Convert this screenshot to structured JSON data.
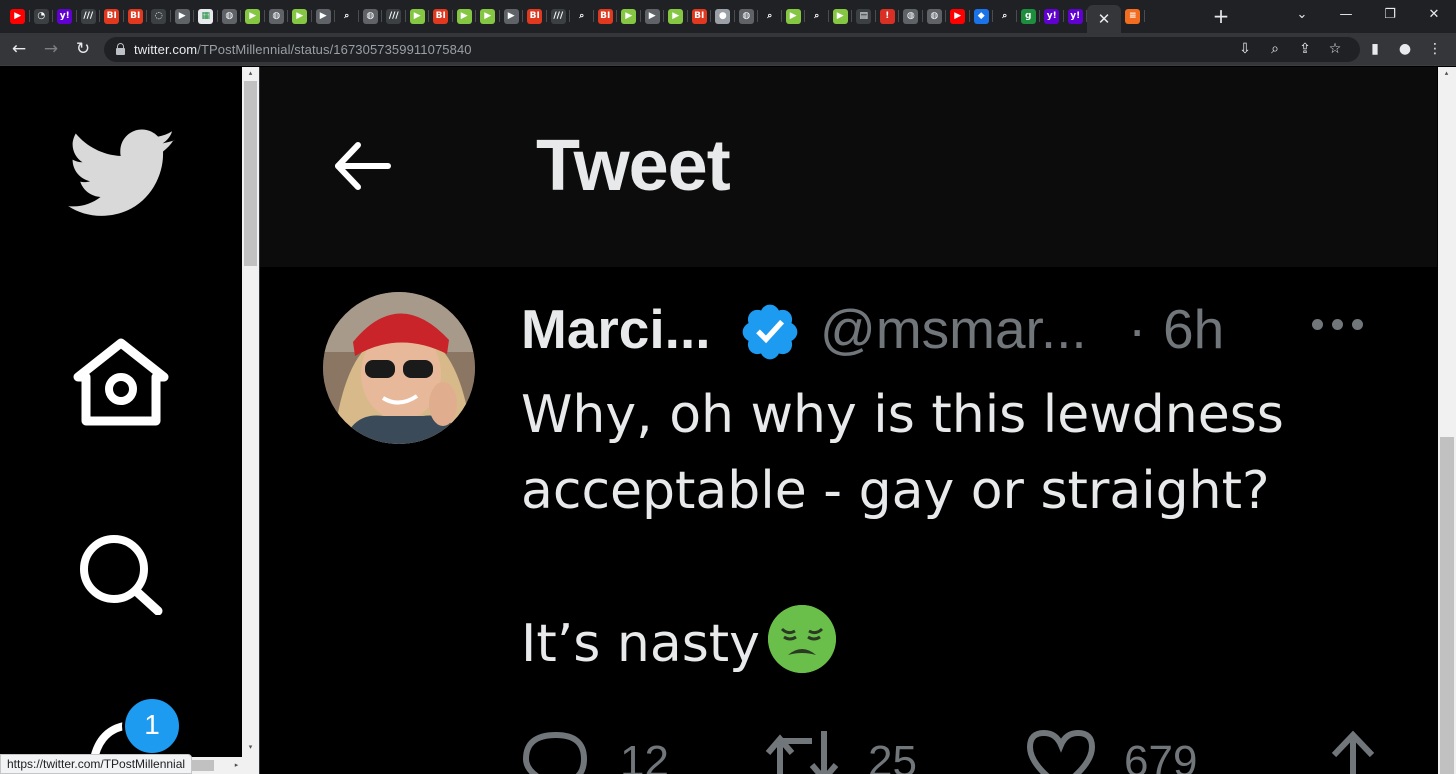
{
  "browser": {
    "tabs": [
      {
        "icon": "youtube-icon",
        "label": "",
        "color": "#ff0000",
        "glyph": "▶"
      },
      {
        "icon": "generic-icon",
        "label": "",
        "color": "#3c4043",
        "glyph": "◔"
      },
      {
        "icon": "yahoo-icon",
        "label": "y!",
        "color": "#6001d2",
        "glyph": "y!"
      },
      {
        "icon": "wsj-icon",
        "label": "",
        "color": "#3c4043",
        "glyph": "///"
      },
      {
        "icon": "bi-icon",
        "label": "BI",
        "color": "#e0391f",
        "glyph": "BI"
      },
      {
        "icon": "bi-icon",
        "label": "BI",
        "color": "#e0391f",
        "glyph": "BI"
      },
      {
        "icon": "shield-icon",
        "label": "",
        "color": "#3c4043",
        "glyph": "◌"
      },
      {
        "icon": "bookmark-icon",
        "label": "",
        "color": "#5f6368",
        "glyph": "▶"
      },
      {
        "icon": "grid-icon",
        "label": "",
        "color": "#e8eaed",
        "glyph": "▦"
      },
      {
        "icon": "globe-icon",
        "label": "",
        "color": "#5f6368",
        "glyph": "◍"
      },
      {
        "icon": "rumble-icon",
        "label": "",
        "color": "#85c742",
        "glyph": "▶"
      },
      {
        "icon": "globe-icon",
        "label": "",
        "color": "#5f6368",
        "glyph": "◍"
      },
      {
        "icon": "rumble-icon",
        "label": "",
        "color": "#85c742",
        "glyph": "▶"
      },
      {
        "icon": "bookmark-icon",
        "label": "",
        "color": "#5f6368",
        "glyph": "▶"
      },
      {
        "icon": "search-icon",
        "label": "",
        "color": "#202124",
        "glyph": "⌕"
      },
      {
        "icon": "globe-icon",
        "label": "",
        "color": "#5f6368",
        "glyph": "◍"
      },
      {
        "icon": "wsj-icon",
        "label": "",
        "color": "#3c4043",
        "glyph": "///"
      },
      {
        "icon": "rumble-icon",
        "label": "",
        "color": "#85c742",
        "glyph": "▶"
      },
      {
        "icon": "bi-icon",
        "label": "BI",
        "color": "#e0391f",
        "glyph": "BI"
      },
      {
        "icon": "rumble-icon",
        "label": "",
        "color": "#85c742",
        "glyph": "▶"
      },
      {
        "icon": "rumble-icon",
        "label": "",
        "color": "#85c742",
        "glyph": "▶"
      },
      {
        "icon": "bookmark-icon",
        "label": "",
        "color": "#5f6368",
        "glyph": "▶"
      },
      {
        "icon": "bi-icon",
        "label": "BI",
        "color": "#e0391f",
        "glyph": "BI"
      },
      {
        "icon": "wsj-icon",
        "label": "",
        "color": "#3c4043",
        "glyph": "///"
      },
      {
        "icon": "search-icon",
        "label": "",
        "color": "#202124",
        "glyph": "⌕"
      },
      {
        "icon": "bi-icon",
        "label": "BI",
        "color": "#e0391f",
        "glyph": "BI"
      },
      {
        "icon": "rumble-icon",
        "label": "",
        "color": "#85c742",
        "glyph": "▶"
      },
      {
        "icon": "bookmark-icon",
        "label": "",
        "color": "#5f6368",
        "glyph": "▶"
      },
      {
        "icon": "rumble-icon",
        "label": "",
        "color": "#85c742",
        "glyph": "▶"
      },
      {
        "icon": "bi-icon",
        "label": "BI",
        "color": "#e0391f",
        "glyph": "BI"
      },
      {
        "icon": "podcast-icon",
        "label": "",
        "color": "#9aa0a6",
        "glyph": "●"
      },
      {
        "icon": "globe-icon",
        "label": "",
        "color": "#5f6368",
        "glyph": "◍"
      },
      {
        "icon": "search-icon",
        "label": "",
        "color": "#202124",
        "glyph": "⌕"
      },
      {
        "icon": "rumble-icon",
        "label": "",
        "color": "#85c742",
        "glyph": "▶"
      },
      {
        "icon": "search-icon",
        "label": "",
        "color": "#202124",
        "glyph": "⌕"
      },
      {
        "icon": "rumble-icon",
        "label": "",
        "color": "#85c742",
        "glyph": "▶"
      },
      {
        "icon": "news-icon",
        "label": "",
        "color": "#3c4043",
        "glyph": "▤"
      },
      {
        "icon": "alert-icon",
        "label": "",
        "color": "#d93025",
        "glyph": "!"
      },
      {
        "icon": "globe-icon",
        "label": "",
        "color": "#5f6368",
        "glyph": "◍"
      },
      {
        "icon": "globe-icon",
        "label": "",
        "color": "#5f6368",
        "glyph": "◍"
      },
      {
        "icon": "youtube-icon",
        "label": "",
        "color": "#ff0000",
        "glyph": "▶"
      },
      {
        "icon": "chat-icon",
        "label": "",
        "color": "#1a73e8",
        "glyph": "◆"
      },
      {
        "icon": "search-icon",
        "label": "",
        "color": "#202124",
        "glyph": "⌕"
      },
      {
        "icon": "g-icon",
        "label": "g",
        "color": "#1e8e3e",
        "glyph": "g"
      },
      {
        "icon": "yahoo-icon",
        "label": "y!",
        "color": "#6001d2",
        "glyph": "y!"
      },
      {
        "icon": "yahoo-icon",
        "label": "y!",
        "color": "#6001d2",
        "glyph": "y!"
      }
    ],
    "url_host": "twitter.com",
    "url_path": "/TPostMillennial/status/1673057359911075840",
    "status_url": "https://twitter.com/TPostMillennial"
  },
  "page": {
    "header_title": "Tweet",
    "notification_count": "1",
    "tweet": {
      "author_name": "Marci...",
      "author_handle": "@msmar...",
      "separator": "·",
      "time": "6h",
      "lines": [
        "Why, oh why is this lewdness",
        "acceptable - gay or straight?"
      ],
      "line_after": "It’s nasty",
      "emoji": "nauseated-face-icon",
      "replies": "12",
      "retweets": "25",
      "likes": "679"
    }
  },
  "colors": {
    "twitter_blue": "#1d9bf0",
    "text_primary": "#e7e9ea",
    "text_secondary": "#71767b",
    "background": "#000000"
  }
}
